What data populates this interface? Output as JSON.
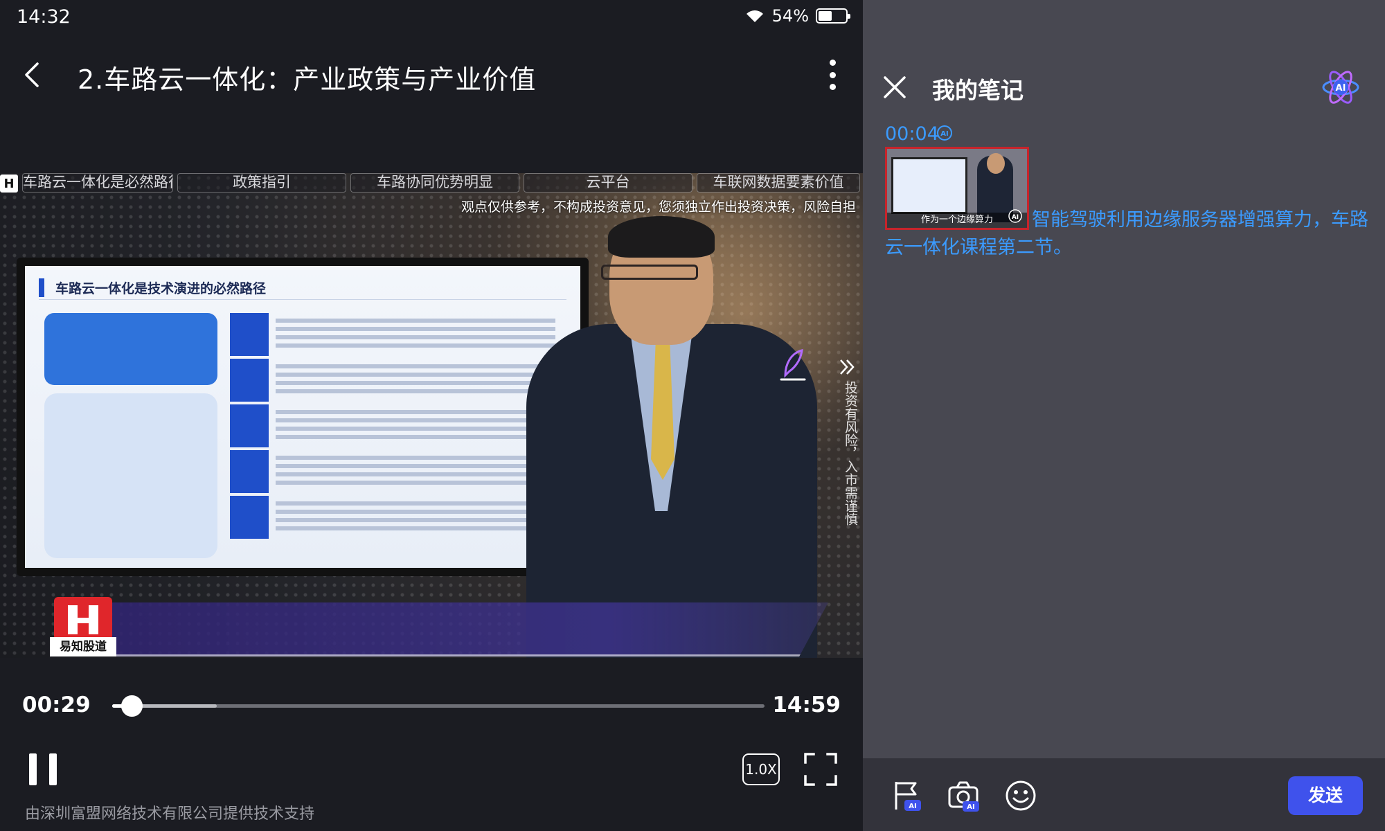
{
  "status_bar": {
    "time": "14:32",
    "battery_percent": "54%",
    "battery_level": 0.54
  },
  "header": {
    "title": "2.车路云一体化：产业政策与产业价值"
  },
  "video": {
    "chapters": [
      "车路云一体化是必然路径",
      "政策指引",
      "车路协同优势明显",
      "云平台",
      "车联网数据要素价值"
    ],
    "disclaimer": "观点仅供参考，不构成投资意见，您须独立作出投资决策，风险自担",
    "slide_title": "车路云一体化是技术演进的必然路径",
    "side_notice": "投资有风险，入市需谨慎",
    "channel_name": "易知股道"
  },
  "controls": {
    "current_time": "00:29",
    "total_time": "14:59",
    "played_fraction": 0.03,
    "buffered_fraction": 0.16,
    "speed_label": "1.0X"
  },
  "provider": "由深圳富盟网络技术有限公司提供技术支持",
  "notes": {
    "title": "我的笔记",
    "entry": {
      "timestamp": "00:04",
      "thumbnail_caption": "作为一个边缘算力",
      "text": "智能驾驶利用边缘服务器增强算力，车路云一体化课程第二节。"
    },
    "send_label": "发送"
  },
  "colors": {
    "accent": "#3f52ec",
    "note_text": "#3b9bff",
    "panel_bg": "#484851",
    "player_bg": "#1b1c22"
  },
  "icons": [
    "back-icon",
    "more-vertical-icon",
    "wifi-icon",
    "battery-icon",
    "feather-pen-icon",
    "double-chevron-right-icon",
    "pause-icon",
    "fullscreen-icon",
    "close-icon",
    "ai-atom-icon",
    "ai-flag-icon",
    "ai-camera-icon",
    "emoji-icon"
  ]
}
